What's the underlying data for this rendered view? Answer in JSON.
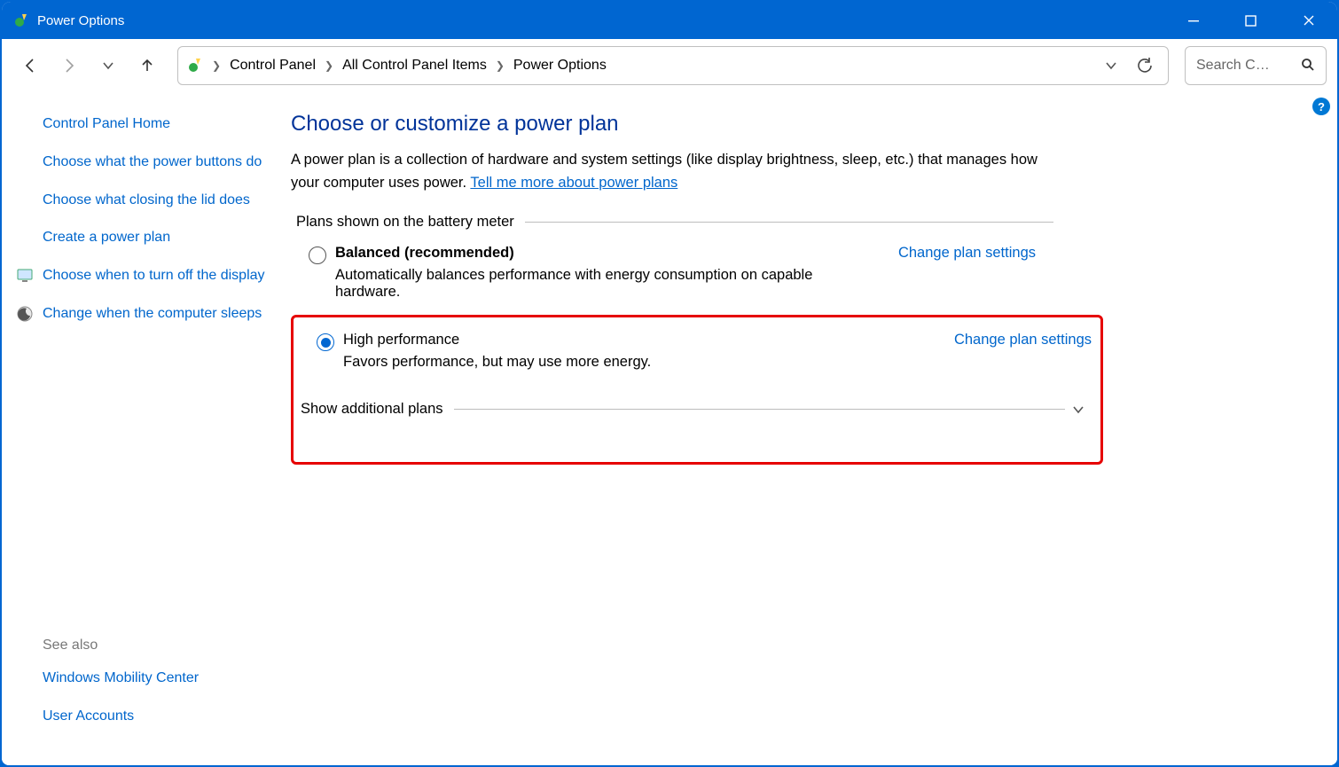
{
  "window": {
    "title": "Power Options"
  },
  "breadcrumb": {
    "seg1": "Control Panel",
    "seg2": "All Control Panel Items",
    "seg3": "Power Options"
  },
  "search": {
    "placeholder": "Search C…"
  },
  "sidebar": {
    "home": "Control Panel Home",
    "link1": "Choose what the power buttons do",
    "link2": "Choose what closing the lid does",
    "link3": "Create a power plan",
    "link4": "Choose when to turn off the display",
    "link5": "Change when the computer sleeps",
    "see_also_label": "See also",
    "see_also1": "Windows Mobility Center",
    "see_also2": "User Accounts"
  },
  "main": {
    "heading": "Choose or customize a power plan",
    "desc_part1": "A power plan is a collection of hardware and system settings (like display brightness, sleep, etc.) that manages how your computer uses power. ",
    "desc_link": "Tell me more about power plans",
    "group1_label": "Plans shown on the battery meter",
    "plan_balanced": {
      "title": "Balanced (recommended)",
      "sub": "Automatically balances performance with energy consumption on capable hardware.",
      "link": "Change plan settings"
    },
    "plan_high": {
      "title": "High performance",
      "sub": "Favors performance, but may use more energy.",
      "link": "Change plan settings"
    },
    "group2_label": "Show additional plans"
  }
}
